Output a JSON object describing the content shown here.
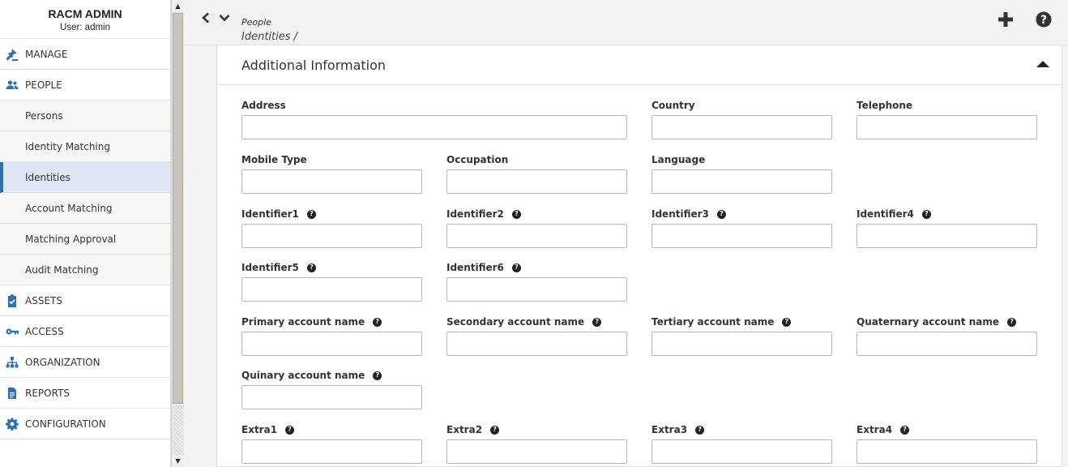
{
  "sidebar": {
    "brand_title": "RACM ADMIN",
    "brand_user": "User: admin",
    "items": [
      {
        "label": "MANAGE",
        "icon": "gavel-icon"
      },
      {
        "label": "PEOPLE",
        "icon": "people-icon"
      },
      {
        "label": "Persons"
      },
      {
        "label": "Identity Matching"
      },
      {
        "label": "Identities",
        "active": true
      },
      {
        "label": "Account Matching"
      },
      {
        "label": "Matching Approval"
      },
      {
        "label": "Audit Matching"
      },
      {
        "label": "ASSETS",
        "icon": "clipboard-check-icon"
      },
      {
        "label": "ACCESS",
        "icon": "key-icon"
      },
      {
        "label": "ORGANIZATION",
        "icon": "sitemap-icon"
      },
      {
        "label": "REPORTS",
        "icon": "document-icon"
      },
      {
        "label": "CONFIGURATION",
        "icon": "gear-icon"
      }
    ]
  },
  "topbar": {
    "breadcrumb_parent": "People",
    "breadcrumb_current": "Identities /",
    "icons": [
      "chevron-left-icon",
      "chevron-down-icon",
      "plus-icon",
      "help-circle-icon"
    ]
  },
  "panel": {
    "title": "Additional Information",
    "fields": {
      "address": "Address",
      "country": "Country",
      "telephone": "Telephone",
      "mobile_type": "Mobile Type",
      "occupation": "Occupation",
      "language": "Language",
      "identifier1": "Identifier1",
      "identifier2": "Identifier2",
      "identifier3": "Identifier3",
      "identifier4": "Identifier4",
      "identifier5": "Identifier5",
      "identifier6": "Identifier6",
      "primary_account": "Primary account name",
      "secondary_account": "Secondary account name",
      "tertiary_account": "Tertiary account name",
      "quaternary_account": "Quaternary account name",
      "quinary_account": "Quinary account name",
      "extra1": "Extra1",
      "extra2": "Extra2",
      "extra3": "Extra3",
      "extra4": "Extra4"
    }
  },
  "colors": {
    "accent": "#2f6fb3",
    "active_bg": "#dfe7f5",
    "panel_bg": "#ffffff",
    "page_bg": "#f3f3f3"
  }
}
